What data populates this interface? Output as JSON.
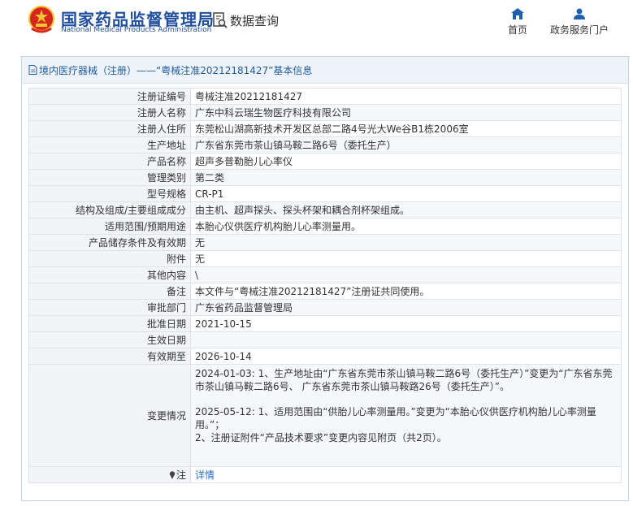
{
  "header": {
    "site_name_cn": "国家药品监督管理局",
    "site_name_en": "National Medical Products Administration",
    "query_label": "数据查询",
    "nav": [
      {
        "label": "首页",
        "icon": "home-icon"
      },
      {
        "label": "政务服务门户",
        "icon": "user-icon"
      }
    ]
  },
  "panel": {
    "title": "境内医疗器械（注册）——“粤械注准20212181427”基本信息"
  },
  "fields": {
    "reg_no": {
      "label": "注册证编号",
      "value": "粤械注准20212181427"
    },
    "registrant": {
      "label": "注册人名称",
      "value": "广东中科云瑞生物医疗科技有限公司"
    },
    "registrant_address": {
      "label": "注册人住所",
      "value": "东莞松山湖高新技术开发区总部二路4号光大We谷B1栋2006室"
    },
    "production_address": {
      "label": "生产地址",
      "value": "广东省东莞市茶山镇马鞍二路6号（委托生产）"
    },
    "product_name": {
      "label": "产品名称",
      "value": "超声多普勒胎儿心率仪"
    },
    "category": {
      "label": "管理类别",
      "value": "第二类"
    },
    "model": {
      "label": "型号规格",
      "value": "CR-P1"
    },
    "structure": {
      "label": "结构及组成/主要组成成分",
      "value": "由主机、超声探头、探头杯架和耦合剂杯架组成。"
    },
    "scope": {
      "label": "适用范围/预期用途",
      "value": "本胎心仪供医疗机构胎儿心率测量用。"
    },
    "storage": {
      "label": "产品储存条件及有效期",
      "value": "无"
    },
    "attachment": {
      "label": "附件",
      "value": "无"
    },
    "other": {
      "label": "其他内容",
      "value": "\\"
    },
    "remarks": {
      "label": "备注",
      "value": "本文件与“粤械注准20212181427”注册证共同使用。"
    },
    "approval_dept": {
      "label": "审批部门",
      "value": "广东省药品监督管理局"
    },
    "approval_date": {
      "label": "批准日期",
      "value": "2021-10-15"
    },
    "effective_date": {
      "label": "生效日期",
      "value": ""
    },
    "valid_until": {
      "label": "有效期至",
      "value": "2026-10-14"
    },
    "changes": {
      "label": "变更情况",
      "entry1": "2024-01-03: 1、生产地址由“广东省东莞市茶山镇马鞍二路6号（委托生产）”变更为“广东省东莞市茶山镇马鞍二路6号、 广东省东莞市茶山镇马鞍路26号（委托生产）”。",
      "entry2_line1": "2025-05-12: 1、适用范围由“供胎儿心率测量用。”变更为“本胎心仪供医疗机构胎儿心率测量用。”；",
      "entry2_line2": "2、注册证附件“产品技术要求”变更内容见附页（共2页）。"
    },
    "note": {
      "label": "注",
      "link": "详情"
    }
  },
  "colors": {
    "brand_blue": "#1f4f9c",
    "link_blue": "#2a6bc4",
    "emblem_red": "#d7261e",
    "emblem_gold": "#f2c230"
  }
}
